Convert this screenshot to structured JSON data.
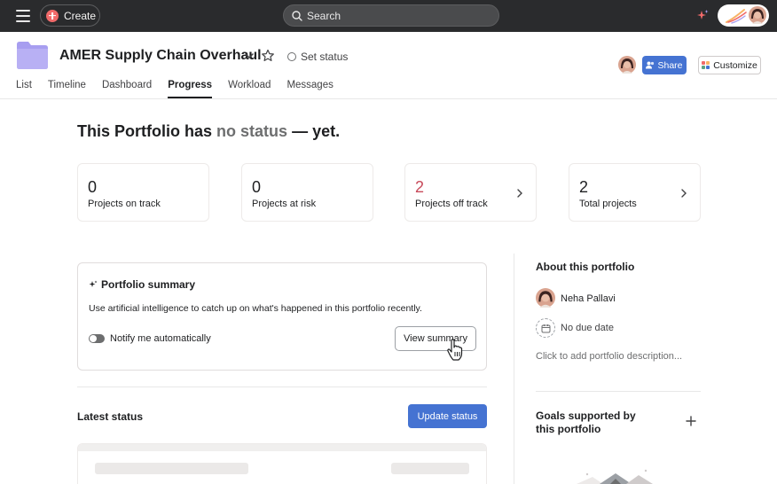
{
  "topbar": {
    "create_label": "Create",
    "search_placeholder": "Search"
  },
  "header": {
    "project_title": "AMER Supply Chain Overhaul",
    "set_status_label": "Set status",
    "share_label": "Share",
    "customize_label": "Customize"
  },
  "tabs": [
    {
      "label": "List",
      "active": false
    },
    {
      "label": "Timeline",
      "active": false
    },
    {
      "label": "Dashboard",
      "active": false
    },
    {
      "label": "Progress",
      "active": true
    },
    {
      "label": "Workload",
      "active": false
    },
    {
      "label": "Messages",
      "active": false
    }
  ],
  "headline": {
    "prefix": "This Portfolio has",
    "highlight": "no status",
    "suffix": "— yet."
  },
  "stats": [
    {
      "value": "0",
      "label": "Projects on track"
    },
    {
      "value": "0",
      "label": "Projects at risk"
    },
    {
      "value": "2",
      "label": "Projects off track"
    },
    {
      "value": "2",
      "label": "Total projects"
    }
  ],
  "summary": {
    "title": "Portfolio summary",
    "description": "Use artificial intelligence to catch up on what's happened in this portfolio recently.",
    "toggle_label": "Notify me automatically",
    "view_button": "View summary"
  },
  "latest_status": {
    "title": "Latest status",
    "update_button": "Update status"
  },
  "about": {
    "title": "About this portfolio",
    "owner_name": "Neha Pallavi",
    "due_date": "No due date",
    "description_placeholder": "Click to add portfolio description..."
  },
  "goals": {
    "title": "Goals supported by this portfolio"
  },
  "colors": {
    "topbar_bg": "#2a2b2d",
    "accent_blue": "#4573d2",
    "off_track_red": "#c84a5a",
    "create_red": "#f06a6a",
    "folder_purple": "#a79ef0"
  }
}
